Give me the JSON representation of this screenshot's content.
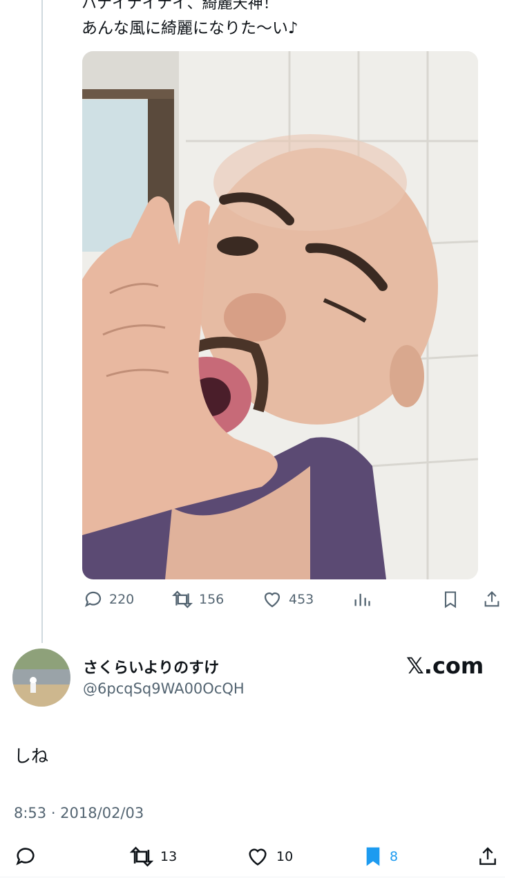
{
  "tweet": {
    "text": "あんな風に綺麗になりた〜い♪",
    "cut_text": "ハナイナイナイ、綺麗天神！",
    "stats": {
      "replies": "220",
      "retweets": "156",
      "likes": "453"
    }
  },
  "reply": {
    "name": "さくらいよりのすけ",
    "handle": "@6pcqSq9WA00OcQH",
    "brand": "𝕏.com",
    "text": "しね",
    "timestamp": "8:53 · 2018/02/03",
    "stats": {
      "retweets": "13",
      "likes": "10",
      "bookmarks": "8"
    }
  },
  "colors": {
    "text": "#0f1419",
    "muted": "#536471",
    "accent": "#1d9bf0",
    "border": "#cfd9de"
  },
  "icons": [
    "reply-icon",
    "retweet-icon",
    "like-icon",
    "views-icon",
    "bookmark-icon",
    "share-icon"
  ]
}
